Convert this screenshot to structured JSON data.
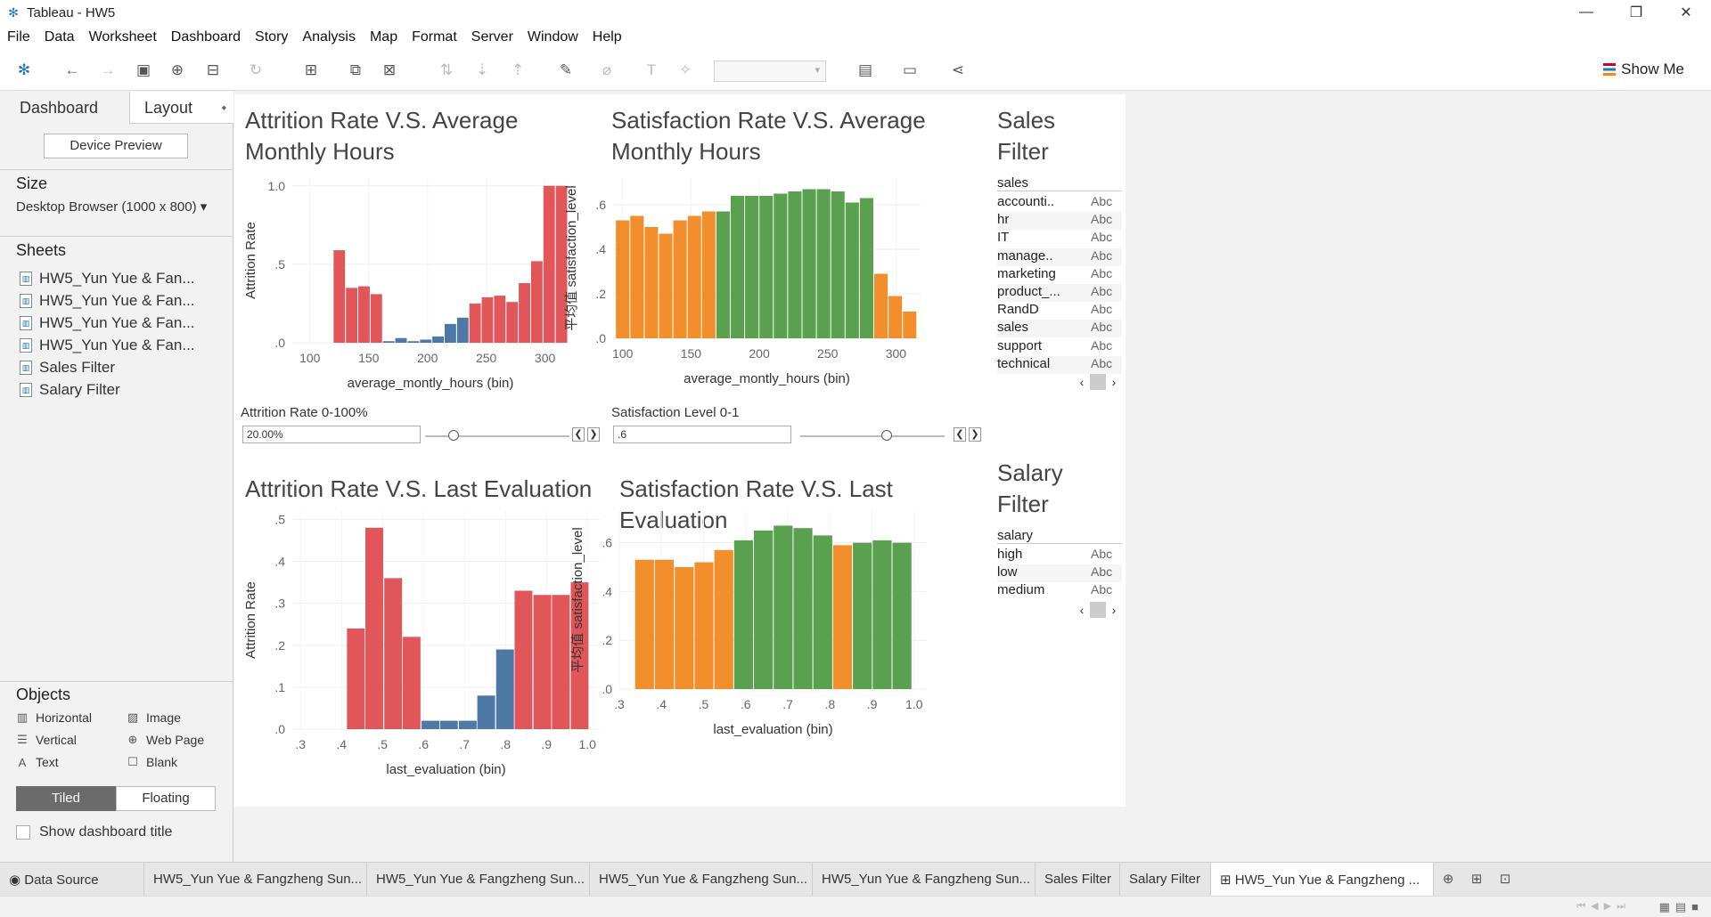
{
  "window": {
    "title": "Tableau - HW5",
    "minimize": "—",
    "restore": "❐",
    "close": "✕"
  },
  "menu": [
    "File",
    "Data",
    "Worksheet",
    "Dashboard",
    "Story",
    "Analysis",
    "Map",
    "Format",
    "Server",
    "Window",
    "Help"
  ],
  "toolbar": {
    "show_me": "Show Me"
  },
  "left_panel": {
    "tab_dashboard": "Dashboard",
    "tab_layout": "Layout",
    "device_preview": "Device Preview",
    "size_heading": "Size",
    "size_value": "Desktop Browser (1000 x 800)",
    "sheets_heading": "Sheets",
    "sheets": [
      "HW5_Yun Yue & Fan...",
      "HW5_Yun Yue & Fan...",
      "HW5_Yun Yue & Fan...",
      "HW5_Yun Yue & Fan...",
      "Sales Filter",
      "Salary Filter"
    ],
    "objects_heading": "Objects",
    "objects": [
      {
        "label": "Horizontal",
        "icon": "horizontal-icon"
      },
      {
        "label": "Image",
        "icon": "image-icon"
      },
      {
        "label": "Vertical",
        "icon": "vertical-icon"
      },
      {
        "label": "Web Page",
        "icon": "globe-icon"
      },
      {
        "label": "Text",
        "icon": "text-icon"
      },
      {
        "label": "Blank",
        "icon": "blank-icon"
      }
    ],
    "tiled": "Tiled",
    "floating": "Floating",
    "show_dashboard_title": "Show dashboard title"
  },
  "params": {
    "attrition": {
      "title": "Attrition Rate 0-100%",
      "value": "20.00%",
      "position": 0.2
    },
    "satisfaction": {
      "title": "Satisfaction Level  0-1",
      "value": ".6",
      "position": 0.6
    }
  },
  "chart_data": [
    {
      "type": "bar",
      "title": "Attrition Rate V.S. Average Monthly Hours",
      "xlabel": "average_montly_hours (bin)",
      "ylabel": "Attrition Rate",
      "xlim": [
        85,
        320
      ],
      "ylim": [
        0,
        1.05
      ],
      "xticks": [
        "100",
        "150",
        "200",
        "250",
        "300"
      ],
      "xtick_values": [
        100,
        150,
        200,
        250,
        300
      ],
      "yticks": [
        "1.0",
        ".5",
        ".0"
      ],
      "ytick_values": [
        1.0,
        0.5,
        0.0
      ],
      "bin_width": 10.5,
      "x": [
        125,
        135.5,
        146,
        156.5,
        167,
        177.5,
        188,
        198.5,
        209,
        219.5,
        230,
        240.5,
        251,
        261.5,
        272,
        282.5,
        293,
        303.5,
        314
      ],
      "values": [
        0.59,
        0.35,
        0.36,
        0.31,
        0.01,
        0.03,
        0.01,
        0.02,
        0.04,
        0.12,
        0.16,
        0.25,
        0.29,
        0.3,
        0.26,
        0.38,
        0.52,
        1.0,
        1.0
      ],
      "colors": [
        "#e15759",
        "#e15759",
        "#e15759",
        "#e15759",
        "#4e79a7",
        "#4e79a7",
        "#4e79a7",
        "#4e79a7",
        "#4e79a7",
        "#4e79a7",
        "#4e79a7",
        "#e15759",
        "#e15759",
        "#e15759",
        "#e15759",
        "#e15759",
        "#e15759",
        "#e15759",
        "#e15759"
      ]
    },
    {
      "type": "bar",
      "title": "Satisfaction Rate V.S. Average Monthly Hours",
      "xlabel": "average_montly_hours (bin)",
      "ylabel": "平均值 satisfaction_level",
      "xlim": [
        93,
        318
      ],
      "ylim": [
        0,
        0.72
      ],
      "xticks": [
        "100",
        "150",
        "200",
        "250",
        "300"
      ],
      "xtick_values": [
        100,
        150,
        200,
        250,
        300
      ],
      "yticks": [
        ".6",
        ".4",
        ".2",
        ".0"
      ],
      "ytick_values": [
        0.6,
        0.4,
        0.2,
        0.0
      ],
      "bin_width": 10.5,
      "x": [
        100,
        110.5,
        121,
        131.5,
        142,
        152.5,
        163,
        173.5,
        184,
        194.5,
        205,
        215.5,
        226,
        236.5,
        247,
        257.5,
        268,
        278.5,
        289,
        299.5,
        310
      ],
      "values": [
        0.53,
        0.55,
        0.5,
        0.47,
        0.53,
        0.55,
        0.57,
        0.57,
        0.64,
        0.64,
        0.64,
        0.65,
        0.66,
        0.67,
        0.67,
        0.66,
        0.61,
        0.63,
        0.29,
        0.19,
        0.12,
        0.12
      ],
      "colors": [
        "#f28e2b",
        "#f28e2b",
        "#f28e2b",
        "#f28e2b",
        "#f28e2b",
        "#f28e2b",
        "#f28e2b",
        "#59a14f",
        "#59a14f",
        "#59a14f",
        "#59a14f",
        "#59a14f",
        "#59a14f",
        "#59a14f",
        "#59a14f",
        "#59a14f",
        "#59a14f",
        "#59a14f",
        "#f28e2b",
        "#f28e2b",
        "#f28e2b",
        "#f28e2b"
      ]
    },
    {
      "type": "bar",
      "title": "Attrition Rate V.S. Last Evaluation",
      "xlabel": "last_evaluation (bin)",
      "ylabel": "Attrition Rate",
      "xlim": [
        0.28,
        1.03
      ],
      "ylim": [
        0,
        0.52
      ],
      "xticks": [
        ".3",
        ".4",
        ".5",
        ".6",
        ".7",
        ".8",
        ".9",
        "1.0"
      ],
      "xtick_values": [
        0.3,
        0.4,
        0.5,
        0.6,
        0.7,
        0.8,
        0.9,
        1.0
      ],
      "yticks": [
        ".5",
        ".4",
        ".3",
        ".2",
        ".1",
        ".0"
      ],
      "ytick_values": [
        0.5,
        0.4,
        0.3,
        0.2,
        0.1,
        0.0
      ],
      "bin_width": 0.0455,
      "x": [
        0.435,
        0.48,
        0.526,
        0.571,
        0.617,
        0.662,
        0.708,
        0.753,
        0.799,
        0.844,
        0.89,
        0.935,
        0.981
      ],
      "values": [
        0.24,
        0.48,
        0.36,
        0.22,
        0.02,
        0.02,
        0.02,
        0.08,
        0.19,
        0.33,
        0.32,
        0.32,
        0.35
      ],
      "colors": [
        "#e15759",
        "#e15759",
        "#e15759",
        "#e15759",
        "#4e79a7",
        "#4e79a7",
        "#4e79a7",
        "#4e79a7",
        "#4e79a7",
        "#e15759",
        "#e15759",
        "#e15759",
        "#e15759"
      ]
    },
    {
      "type": "bar",
      "title": "Satisfaction Rate V.S. Last Evaluation",
      "xlabel": "last_evaluation (bin)",
      "ylabel": "平均值 satisfaction_level",
      "xlim": [
        0.3,
        1.03
      ],
      "ylim": [
        0,
        0.73
      ],
      "xticks": [
        ".3",
        ".4",
        ".5",
        ".6",
        ".7",
        ".8",
        ".9",
        "1.0"
      ],
      "xtick_values": [
        0.3,
        0.4,
        0.5,
        0.6,
        0.7,
        0.8,
        0.9,
        1.0
      ],
      "yticks": [
        ".6",
        ".4",
        ".2",
        ".0"
      ],
      "ytick_values": [
        0.6,
        0.4,
        0.2,
        0.0
      ],
      "bin_width": 0.047,
      "x": [
        0.36,
        0.407,
        0.454,
        0.501,
        0.548,
        0.595,
        0.642,
        0.689,
        0.736,
        0.783,
        0.83,
        0.877,
        0.924,
        0.971
      ],
      "values": [
        0.53,
        0.53,
        0.5,
        0.52,
        0.57,
        0.61,
        0.65,
        0.67,
        0.66,
        0.63,
        0.59,
        0.6,
        0.61,
        0.6,
        0.68
      ],
      "colors": [
        "#f28e2b",
        "#f28e2b",
        "#f28e2b",
        "#f28e2b",
        "#f28e2b",
        "#59a14f",
        "#59a14f",
        "#59a14f",
        "#59a14f",
        "#59a14f",
        "#f28e2b",
        "#59a14f",
        "#59a14f",
        "#59a14f",
        "#59a14f"
      ]
    }
  ],
  "filters": {
    "sales": {
      "title": "Sales Filter",
      "header": "sales",
      "rows": [
        {
          "value": "accounti..",
          "alias": "Abc"
        },
        {
          "value": "hr",
          "alias": "Abc"
        },
        {
          "value": "IT",
          "alias": "Abc"
        },
        {
          "value": "manage..",
          "alias": "Abc"
        },
        {
          "value": "marketing",
          "alias": "Abc"
        },
        {
          "value": "product_...",
          "alias": "Abc"
        },
        {
          "value": "RandD",
          "alias": "Abc"
        },
        {
          "value": "sales",
          "alias": "Abc"
        },
        {
          "value": "support",
          "alias": "Abc"
        },
        {
          "value": "technical",
          "alias": "Abc"
        }
      ]
    },
    "salary": {
      "title": "Salary Filter",
      "header": "salary",
      "rows": [
        {
          "value": "high",
          "alias": "Abc"
        },
        {
          "value": "low",
          "alias": "Abc"
        },
        {
          "value": "medium",
          "alias": "Abc"
        }
      ]
    }
  },
  "tabs": [
    {
      "label": "Data Source",
      "active": false
    },
    {
      "label": "HW5_Yun Yue & Fangzheng Sun...",
      "active": false
    },
    {
      "label": "HW5_Yun Yue & Fangzheng Sun...",
      "active": false
    },
    {
      "label": "HW5_Yun Yue & Fangzheng Sun...",
      "active": false
    },
    {
      "label": "HW5_Yun Yue & Fangzheng Sun...",
      "active": false
    },
    {
      "label": "Sales Filter",
      "active": false
    },
    {
      "label": "Salary Filter",
      "active": false
    },
    {
      "label": "HW5_Yun Yue & Fangzheng ...",
      "active": true
    }
  ]
}
